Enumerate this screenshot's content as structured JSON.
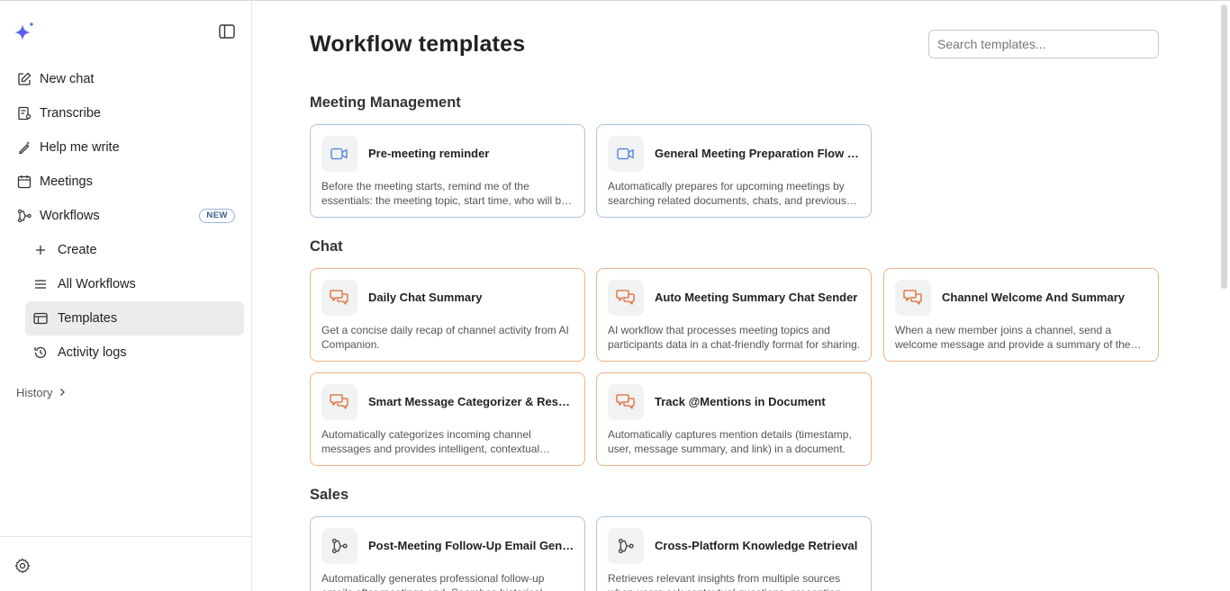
{
  "sidebar": {
    "nav": [
      {
        "label": "New chat",
        "icon": "edit-icon"
      },
      {
        "label": "Transcribe",
        "icon": "transcribe-icon"
      },
      {
        "label": "Help me write",
        "icon": "magic-pen-icon"
      },
      {
        "label": "Meetings",
        "icon": "calendar-icon"
      },
      {
        "label": "Workflows",
        "icon": "workflow-icon",
        "badge": "NEW"
      }
    ],
    "sub": [
      {
        "label": "Create",
        "icon": "plus-icon"
      },
      {
        "label": "All Workflows",
        "icon": "list-icon"
      },
      {
        "label": "Templates",
        "icon": "template-icon"
      },
      {
        "label": "Activity logs",
        "icon": "history-icon"
      }
    ],
    "history_label": "History"
  },
  "main": {
    "title": "Workflow templates",
    "search_placeholder": "Search templates...",
    "sections": [
      {
        "title": "Meeting Management",
        "cards": [
          {
            "title": "Pre-meeting reminder",
            "desc": "Before the meeting starts, remind me of the essentials: the meeting topic, start time, who will be attending and key documents.",
            "icon": "video-icon"
          },
          {
            "title": "General Meeting Preparation Flow with Docs",
            "desc": "Automatically prepares for upcoming meetings by searching related documents, chats, and previous meeting notes.",
            "icon": "video-icon"
          }
        ]
      },
      {
        "title": "Chat",
        "cards": [
          {
            "title": "Daily Chat Summary",
            "desc": "Get a concise daily recap of channel activity from AI Companion.",
            "icon": "chat-icon"
          },
          {
            "title": "Auto Meeting Summary Chat Sender",
            "desc": "AI workflow that processes meeting topics and participants data in a chat-friendly format for sharing.",
            "icon": "chat-icon"
          },
          {
            "title": "Channel Welcome And Summary",
            "desc": "When a new member joins a channel, send a welcome message and provide a summary of the channel.",
            "icon": "chat-icon"
          },
          {
            "title": "Smart Message Categorizer & Responder",
            "desc": "Automatically categorizes incoming channel messages and provides intelligent, contextual responses.",
            "icon": "chat-icon"
          },
          {
            "title": "Track @Mentions in Document",
            "desc": "Automatically captures mention details (timestamp, user, message summary, and link) in a document.",
            "icon": "chat-icon"
          }
        ]
      },
      {
        "title": "Sales",
        "cards": [
          {
            "title": "Post-Meeting Follow-Up Email Generator",
            "desc": "Automatically generates professional follow-up emails after meetings end. Searches historical context.",
            "icon": "workflow-icon"
          },
          {
            "title": "Cross-Platform Knowledge Retrieval",
            "desc": "Retrieves relevant insights from multiple sources when users ask contextual questions, presenting answers.",
            "icon": "workflow-icon"
          }
        ]
      }
    ]
  },
  "colors": {
    "meeting_border": "#a9c4e4",
    "chat_border": "#eab28e",
    "meeting_icon": "#4a7fd4",
    "chat_icon": "#e0682a",
    "active_bg": "#ececee"
  }
}
